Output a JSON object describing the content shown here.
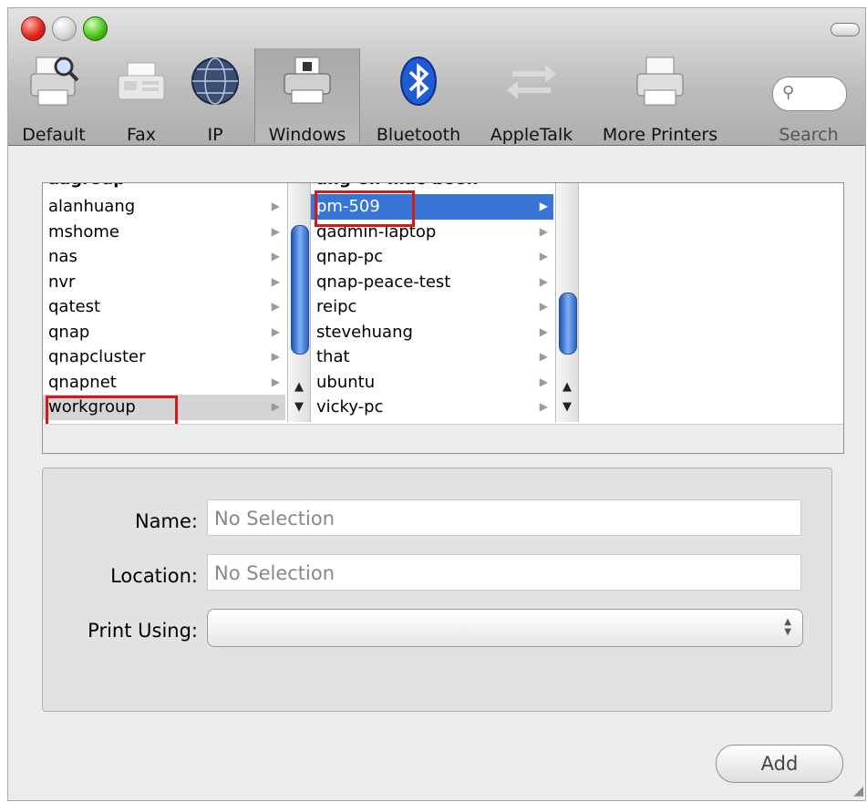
{
  "toolbar": {
    "items": [
      {
        "label": "Default"
      },
      {
        "label": "Fax"
      },
      {
        "label": "IP"
      },
      {
        "label": "Windows"
      },
      {
        "label": "Bluetooth"
      },
      {
        "label": "AppleTalk"
      },
      {
        "label": "More Printers"
      }
    ],
    "search_label": "Search"
  },
  "browser": {
    "workgroups": [
      "alanhuang",
      "mshome",
      "nas",
      "nvr",
      "qatest",
      "qnap",
      "qnapcluster",
      "qnapnet",
      "workgroup"
    ],
    "workgroup_partial_top": "aagroup",
    "computers": [
      "pm-509",
      "qadmin-laptop",
      "qnap-pc",
      "qnap-peace-test",
      "reipc",
      "stevehuang",
      "that",
      "ubuntu",
      "vicky-pc"
    ],
    "computers_partial_top": "ang-on-mac-booh",
    "selected_workgroup": "workgroup",
    "selected_computer": "pm-509",
    "highlight_color": "#d11a1a",
    "selection_color": "#3875d7"
  },
  "form": {
    "name_label": "Name:",
    "name_value": "No Selection",
    "location_label": "Location:",
    "location_value": "No Selection",
    "print_using_label": "Print Using:",
    "print_using_value": ""
  },
  "add_button": "Add"
}
